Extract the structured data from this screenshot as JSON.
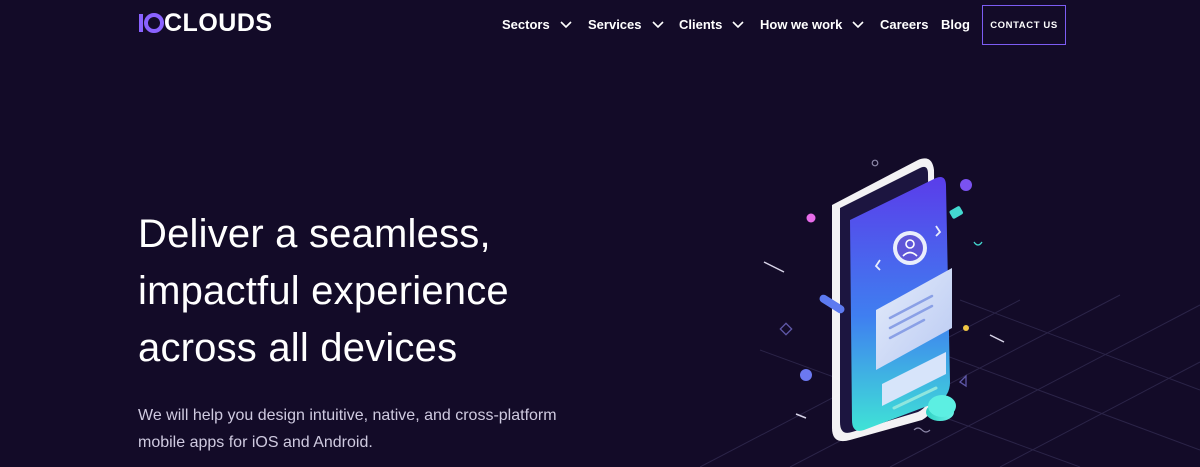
{
  "brand": {
    "logo_text": "CLOUDS",
    "logo_mark": "10",
    "accent_color": "#7c5cf3"
  },
  "nav": {
    "items": [
      {
        "label": "Sectors",
        "has_dropdown": true
      },
      {
        "label": "Services",
        "has_dropdown": true
      },
      {
        "label": "Clients",
        "has_dropdown": true
      },
      {
        "label": "How we work",
        "has_dropdown": true
      },
      {
        "label": "Careers",
        "has_dropdown": false
      },
      {
        "label": "Blog",
        "has_dropdown": false
      }
    ],
    "contact_label": "CONTACT US"
  },
  "hero": {
    "title_lines": [
      "Deliver a seamless,",
      "impactful experience",
      "across all devices"
    ],
    "subtitle_lines": [
      "We will help you design intuitive, native, and cross-platform",
      "mobile apps for iOS and Android."
    ]
  },
  "icons": {
    "chevron": "chevron-down-icon",
    "illustration": "phone-illustration"
  }
}
